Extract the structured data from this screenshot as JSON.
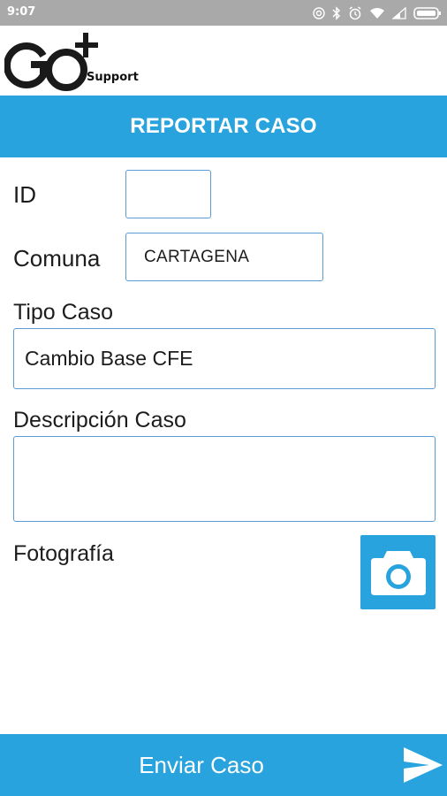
{
  "status_bar": {
    "time": "9:07",
    "icons": [
      "nfc-icon",
      "bluetooth-icon",
      "alarm-icon",
      "wifi-icon",
      "signal-icon",
      "battery-icon"
    ]
  },
  "header": {
    "logo_text": "GO",
    "logo_sub": "Support"
  },
  "title_bar": {
    "title": "REPORTAR CASO"
  },
  "form": {
    "id_label": "ID",
    "id_value": "",
    "comuna_label": "Comuna",
    "comuna_value": "CARTAGENA",
    "tipo_caso_label": "Tipo Caso",
    "tipo_caso_value": "Cambio Base CFE",
    "descripcion_label": "Descripción Caso",
    "descripcion_value": "",
    "fotografia_label": "Fotografía",
    "camera_icon": "camera-icon"
  },
  "bottom_bar": {
    "send_label": "Enviar Caso",
    "send_icon": "send-icon"
  },
  "colors": {
    "primary": "#29a3dd",
    "field_border": "#5b9bd5",
    "status_bar": "#a9a9a9",
    "text": "#1c1c1c"
  }
}
